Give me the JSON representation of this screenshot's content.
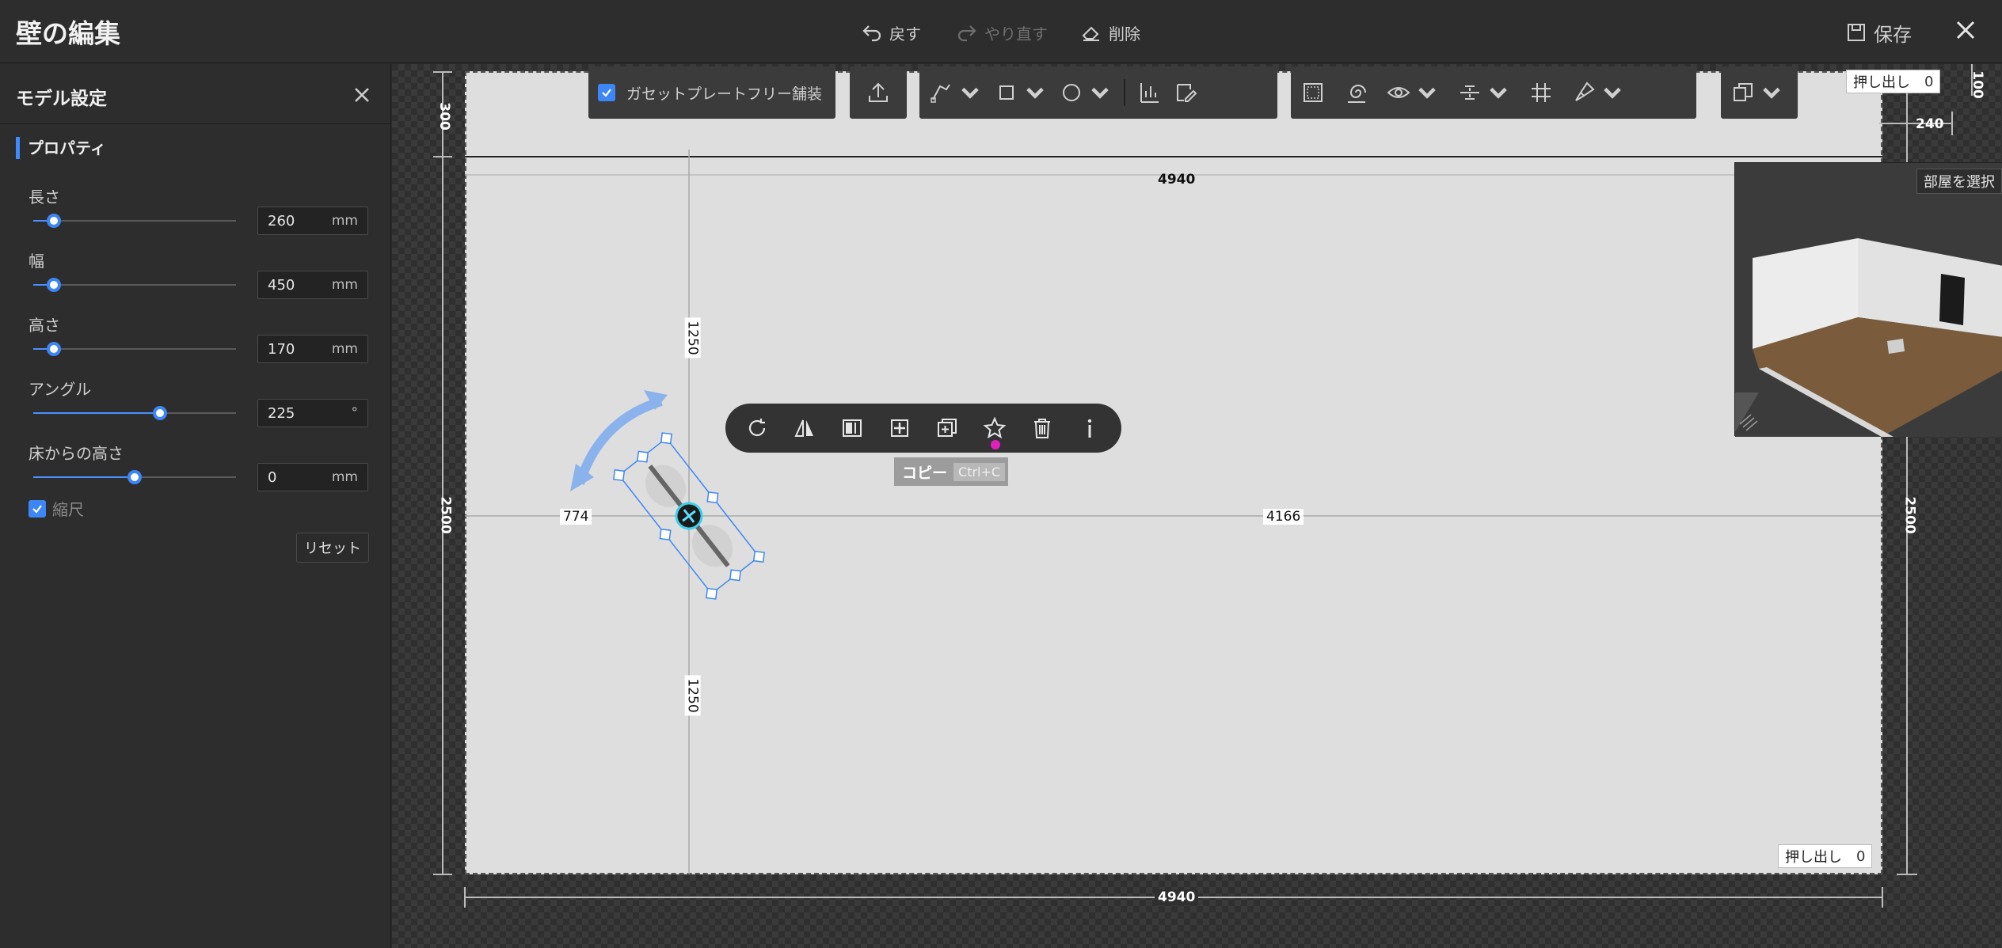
{
  "header": {
    "title": "壁の編集",
    "undo_label": "戻す",
    "redo_label": "やり直す",
    "delete_label": "削除",
    "save_label": "保存"
  },
  "panel": {
    "title": "モデル設定",
    "section": "プロパティ",
    "props": [
      {
        "label": "長さ",
        "value": "260",
        "unit": "mm",
        "slider": 0.1
      },
      {
        "label": "幅",
        "value": "450",
        "unit": "mm",
        "slider": 0.1
      },
      {
        "label": "高さ",
        "value": "170",
        "unit": "mm",
        "slider": 0.1
      },
      {
        "label": "アングル",
        "value": "225",
        "unit": "°",
        "slider": 0.625
      },
      {
        "label": "床からの高さ",
        "value": "0",
        "unit": "mm",
        "slider": 0.5
      }
    ],
    "scale_label": "縮尺",
    "scale_checked": true,
    "reset_label": "リセット"
  },
  "toolbar": {
    "gusset_label": "ガセットプレートフリー舗装",
    "gusset_checked": true,
    "icons": [
      "upload-icon",
      "pen-tool-icon",
      "rectangle-icon",
      "circle-icon",
      "align-icon",
      "edit-note-icon",
      "frame-icon",
      "spiral-icon",
      "eye-icon",
      "distribute-icon",
      "grid-icon",
      "brush-icon",
      "layers-icon"
    ]
  },
  "canvas": {
    "push_top_label": "押し出し",
    "push_top_value": "0",
    "push_bottom_label": "押し出し",
    "push_bottom_value": "0",
    "dims": {
      "top_width": "4940",
      "bottom_width": "4940",
      "left_dist": "774",
      "right_dist": "4166",
      "upper_height": "1250",
      "lower_height": "1250",
      "left_total": "2500",
      "right_total": "2500",
      "left_top_offset": "300",
      "right_top_offset": "240",
      "right_corner": "100"
    },
    "select_room_label": "部屋を選択"
  },
  "context_toolbar": {
    "tooltip_label": "コピー",
    "tooltip_shortcut": "Ctrl+C",
    "icons": [
      "rotate-icon",
      "mirror-icon",
      "align-panel-icon",
      "center-icon",
      "copy-icon",
      "star-icon",
      "trash-icon",
      "info-icon"
    ]
  },
  "colors": {
    "accent": "#3d86f5",
    "wall": "#dedede",
    "panel_bg": "#2d2d2d"
  }
}
